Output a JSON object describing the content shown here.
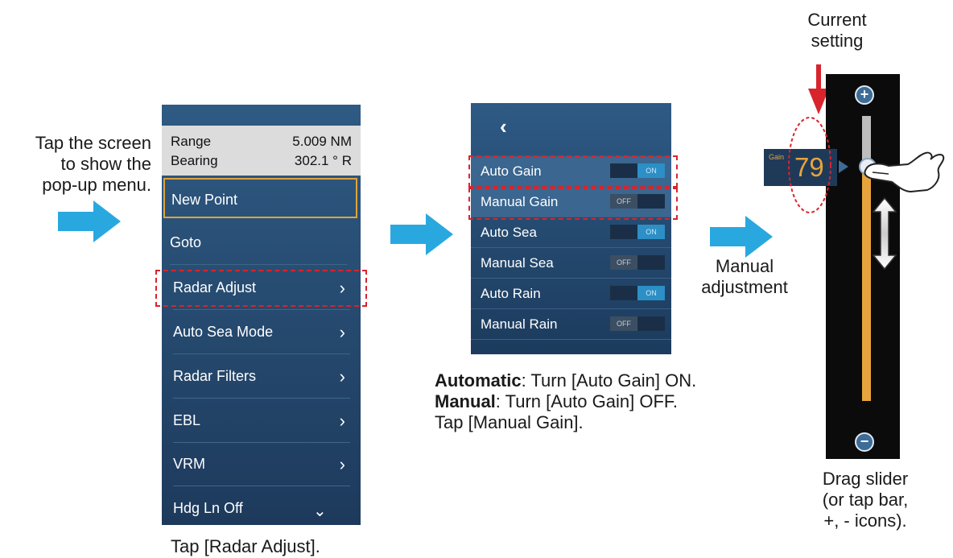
{
  "instructions": {
    "tap_screen": [
      "Tap the screen",
      "to show the",
      "pop-up menu."
    ],
    "tap_radar_adjust": "Tap [Radar Adjust].",
    "automatic_label": "Automatic",
    "automatic_text": ": Turn [Auto Gain] ON.",
    "manual_label": "Manual",
    "manual_text": ": Turn [Auto Gain] OFF.",
    "tap_manual_gain": "Tap [Manual Gain].",
    "manual_adjustment": [
      "Manual",
      "adjustment"
    ],
    "current_setting": [
      "Current",
      "setting"
    ],
    "drag_slider": [
      "Drag slider",
      "(or tap bar,",
      "+, - icons)."
    ]
  },
  "popup_menu": {
    "range_label": "Range",
    "range_value": "5.009 NM",
    "bearing_label": "Bearing",
    "bearing_value": "302.1 ° R",
    "new_point": "New Point",
    "items": [
      "Goto",
      "Radar Adjust",
      "Auto Sea Mode",
      "Radar Filters",
      "EBL",
      "VRM",
      "Hdg Ln Off"
    ],
    "chevron": "›",
    "down_icon": "⌄"
  },
  "radar_adjust": {
    "back_icon": "‹",
    "rows": [
      {
        "label": "Auto Gain",
        "state": "ON"
      },
      {
        "label": "Manual Gain",
        "state": "OFF"
      },
      {
        "label": "Auto Sea",
        "state": "ON"
      },
      {
        "label": "Manual Sea",
        "state": "OFF"
      },
      {
        "label": "Auto Rain",
        "state": "ON"
      },
      {
        "label": "Manual Rain",
        "state": "OFF"
      }
    ]
  },
  "gain_slider": {
    "label": "Gain",
    "value": "79",
    "plus": "+",
    "minus": "−"
  },
  "colors": {
    "accent_blue": "#29a8e0",
    "highlight_dash": "#d8242c",
    "gain_orange": "#e8a43c"
  }
}
